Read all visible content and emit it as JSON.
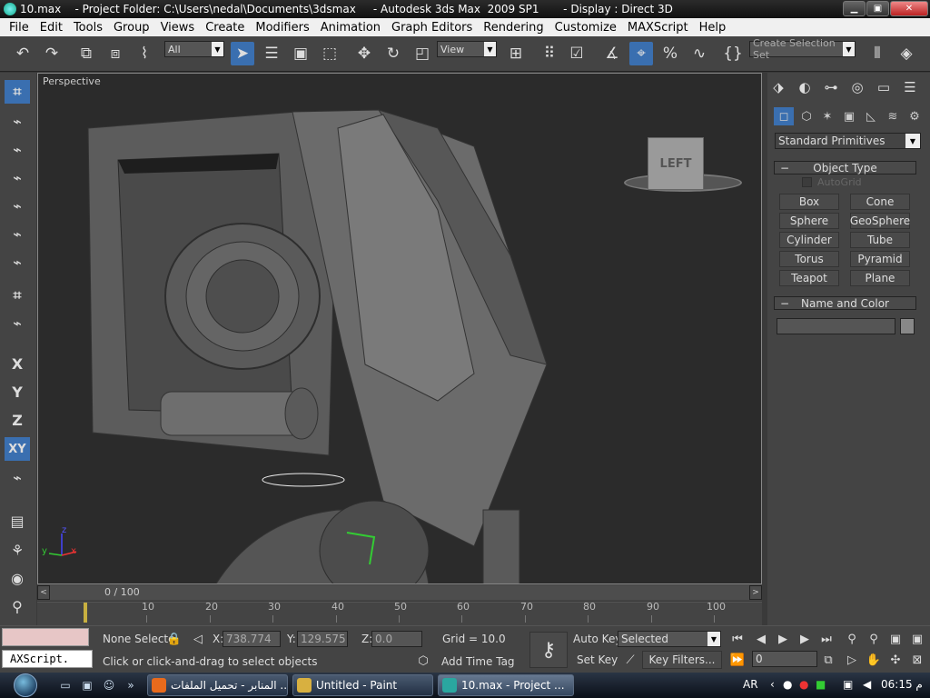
{
  "window": {
    "title": "10.max    - Project Folder: C:\\Users\\nedal\\Documents\\3dsmax     - Autodesk 3ds Max  2009 SP1       - Display : Direct 3D",
    "minimize": "▁",
    "maximize": "▣",
    "close": "✕"
  },
  "menu": [
    "File",
    "Edit",
    "Tools",
    "Group",
    "Views",
    "Create",
    "Modifiers",
    "Animation",
    "Graph Editors",
    "Rendering",
    "Customize",
    "MAXScript",
    "Help"
  ],
  "toolbar": {
    "selection_filter": "All",
    "coord_system": "View",
    "named_selection": "Create Selection Set"
  },
  "left_bar": {
    "x_label": "X",
    "y_label": "Y",
    "z_label": "Z",
    "xy_label": "XY"
  },
  "viewport": {
    "label": "Perspective",
    "viewcube_label": "LEFT",
    "axis_x": "x",
    "axis_y": "y",
    "axis_z": "z"
  },
  "command_panel": {
    "category": "Standard Primitives",
    "object_type_title": "Object Type",
    "autogrid_label": "AutoGrid",
    "primitives": [
      "Box",
      "Cone",
      "Sphere",
      "GeoSphere",
      "Cylinder",
      "Tube",
      "Torus",
      "Pyramid",
      "Teapot",
      "Plane"
    ],
    "name_color_title": "Name and Color",
    "rollout_toggle": "−"
  },
  "timeline": {
    "frame_label": "0 / 100",
    "prev_arrow": "<",
    "next_arrow": ">",
    "ticks": [
      "10",
      "20",
      "30",
      "40",
      "50",
      "60",
      "70",
      "80",
      "90",
      "100"
    ]
  },
  "status": {
    "listener_text": "‎AXScript.",
    "selection_text": "None Selecte",
    "prompt_text": "Click or click-and-drag to select objects",
    "x_label": "X:",
    "x_value": "738.774",
    "y_label": "Y:",
    "y_value": "129.575",
    "z_label": "Z:",
    "z_value": "0.0",
    "grid_text": "Grid = 10.0",
    "add_time_tag": "Add Time Tag",
    "auto_key": "Auto Key",
    "set_key": "Set Key",
    "key_mode": "Selected",
    "key_filters": "Key Filters...",
    "current_frame": "0"
  },
  "taskbar": {
    "tasks": [
      {
        "label": "المنابر - تحميل الملفات ...",
        "color": "#e86a1c"
      },
      {
        "label": "Untitled - Paint",
        "color": "#d8b040"
      },
      {
        "label": "10.max     - Project ...",
        "color": "#2aa7a0"
      }
    ],
    "lang": "AR",
    "clock": "06:15 م"
  }
}
